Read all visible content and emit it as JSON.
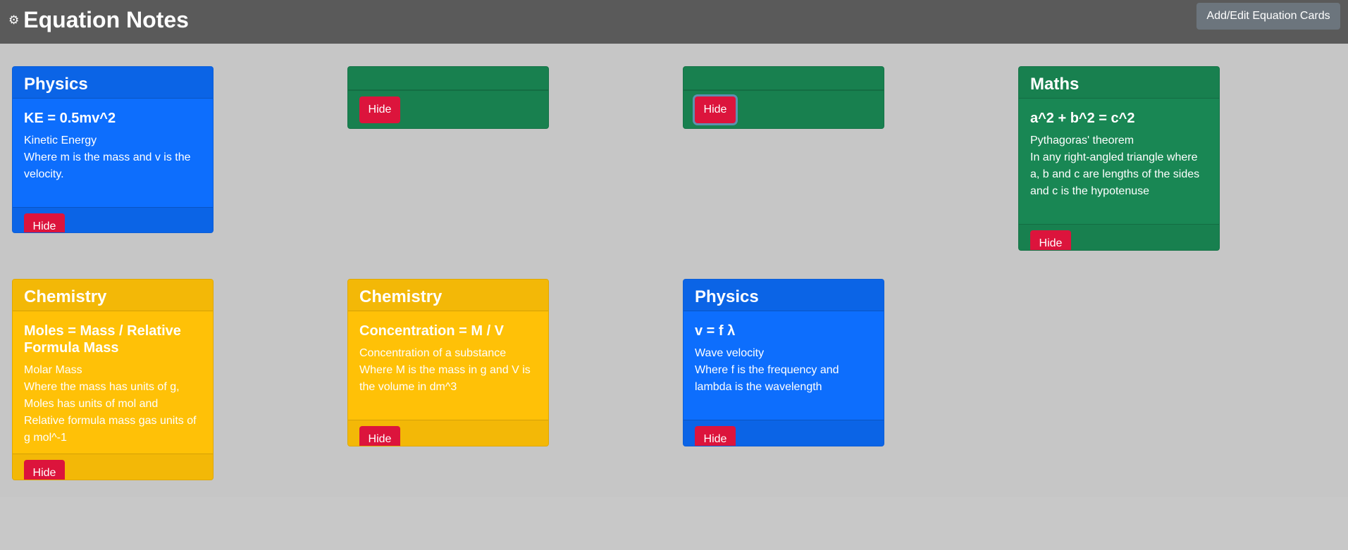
{
  "header": {
    "title": "Equation Notes",
    "icon": "gear-icon",
    "add_edit_label": "Add/Edit Equation Cards"
  },
  "colors": {
    "navbar": "#5a5a5a",
    "background": "#c8c8c8",
    "physics": "#0d6efd",
    "maths": "#198754",
    "chemistry": "#ffc107",
    "hide_button": "#dc143c"
  },
  "cards": [
    {
      "subject": "Physics",
      "equation": "KE = 0.5mv^2",
      "name": "Kinetic Energy",
      "description": "Where m is the mass and v is the velocity.",
      "hide_label": "Hide"
    },
    {
      "subject": "",
      "hide_label": "Hide"
    },
    {
      "subject": "",
      "hide_label": "Hide"
    },
    {
      "subject": "Maths",
      "equation": "a^2 + b^2 = c^2",
      "name": "Pythagoras' theorem",
      "description": "In any right-angled triangle where a, b and c are lengths of the sides and c is the hypotenuse",
      "hide_label": "Hide"
    },
    {
      "subject": "Chemistry",
      "equation": "Moles = Mass / Relative Formula Mass",
      "name": "Molar Mass",
      "description": "Where the mass has units of g, Moles has units of mol and Relative formula mass gas units of g mol^-1",
      "hide_label": "Hide"
    },
    {
      "subject": "Chemistry",
      "equation": "Concentration = M / V",
      "name": "Concentration of a substance",
      "description": "Where M is the mass in g and V is the volume in dm^3",
      "hide_label": "Hide"
    },
    {
      "subject": "Physics",
      "equation": "v = f λ",
      "name": "Wave velocity",
      "description": "Where f is the frequency and lambda is the wavelength",
      "hide_label": "Hide"
    }
  ]
}
